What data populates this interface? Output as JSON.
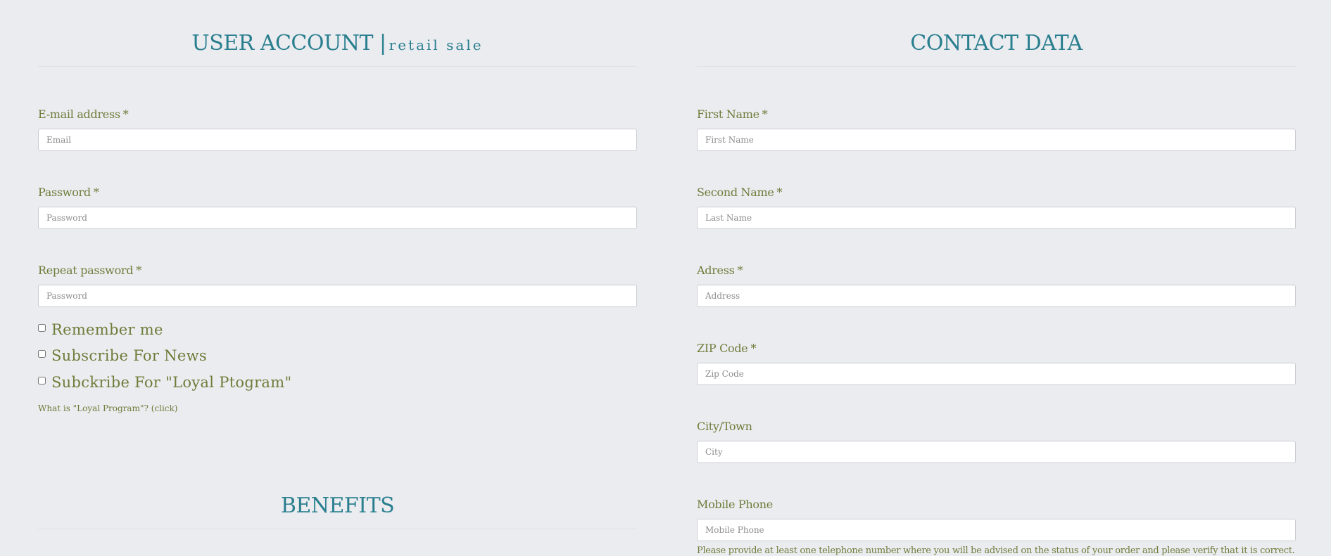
{
  "account": {
    "title": "USER ACCOUNT |",
    "subtitle": "retail sale",
    "fields": [
      {
        "label": "E-mail address",
        "required": "*",
        "placeholder": "Email"
      },
      {
        "label": "Password",
        "required": "*",
        "placeholder": "Password"
      },
      {
        "label": "Repeat password",
        "required": "*",
        "placeholder": "Password"
      }
    ],
    "checkboxes": [
      {
        "label": "Remember me"
      },
      {
        "label": "Subscribe For News"
      },
      {
        "label": "Subckribe For \"Loyal Ptogram\""
      }
    ],
    "loyal_info_link": "What is \"Loyal Program\"? (click)"
  },
  "benefits": {
    "title": "BENEFITS"
  },
  "contact": {
    "title": "CONTACT DATA",
    "fields": [
      {
        "label": "First Name",
        "required": "*",
        "placeholder": "First Name"
      },
      {
        "label": "Second Name",
        "required": "*",
        "placeholder": "Last Name"
      },
      {
        "label": "Adress",
        "required": "*",
        "placeholder": "Address"
      },
      {
        "label": "ZIP Code",
        "required": "*",
        "placeholder": "Zip Code"
      },
      {
        "label": "City/Town",
        "required": "",
        "placeholder": "City"
      },
      {
        "label": "Mobile Phone",
        "required": "",
        "placeholder": "Mobile Phone"
      }
    ],
    "phone_note": "Please provide at least one telephone number where you will be advised on the status of your order and please verify that it is correct."
  }
}
